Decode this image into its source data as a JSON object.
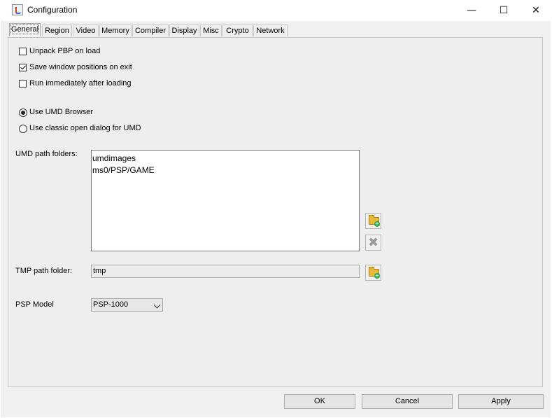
{
  "window": {
    "title": "Configuration",
    "icon": "java-cup-icon",
    "controls": {
      "minimize": "—",
      "maximize": "☐",
      "close": "✕"
    }
  },
  "tabs": [
    {
      "label": "General",
      "active": true
    },
    {
      "label": "Region",
      "active": false
    },
    {
      "label": "Video",
      "active": false
    },
    {
      "label": "Memory",
      "active": false
    },
    {
      "label": "Compiler",
      "active": false
    },
    {
      "label": "Display",
      "active": false
    },
    {
      "label": "Misc",
      "active": false
    },
    {
      "label": "Crypto",
      "active": false
    },
    {
      "label": "Network",
      "active": false
    }
  ],
  "general": {
    "checkboxes": [
      {
        "label": "Unpack PBP on load",
        "checked": false
      },
      {
        "label": "Save window positions on exit",
        "checked": true
      },
      {
        "label": "Run immediately after loading",
        "checked": false
      }
    ],
    "radios": [
      {
        "label": "Use UMD Browser",
        "selected": true
      },
      {
        "label": "Use classic open dialog for UMD",
        "selected": false
      }
    ],
    "umd_paths_label": "UMD path folders:",
    "umd_paths": [
      "umdimages",
      "ms0/PSP/GAME"
    ],
    "tmp_path_label": "TMP path folder:",
    "tmp_path_value": "tmp",
    "psp_model_label": "PSP Model",
    "psp_model_value": "PSP-1000"
  },
  "buttons": {
    "ok": "OK",
    "cancel": "Cancel",
    "apply": "Apply"
  },
  "icons": {
    "add_folder": "folder-add-icon",
    "remove": "remove-x-icon",
    "dropdown": "chevron-down-icon"
  }
}
